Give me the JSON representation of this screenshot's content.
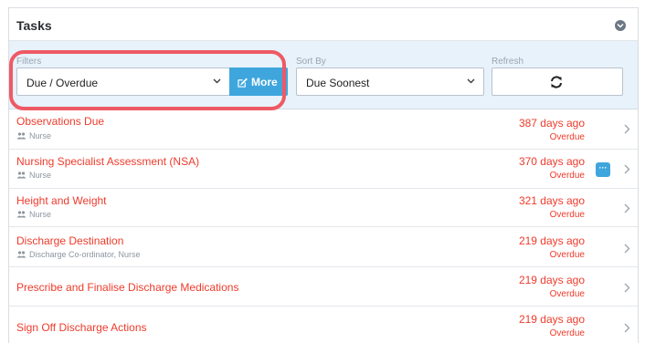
{
  "header": {
    "title": "Tasks"
  },
  "filters": {
    "filters_label": "Filters",
    "filter_value": "Due / Overdue",
    "more_label": "More",
    "sort_label": "Sort By",
    "sort_value": "Due Soonest",
    "refresh_label": "Refresh"
  },
  "tasks": [
    {
      "name": "Observations Due",
      "role": "Nurse",
      "ago": "387 days ago",
      "status": "Overdue"
    },
    {
      "name": "Nursing Specialist Assessment (NSA)",
      "role": "Nurse",
      "ago": "370 days ago",
      "status": "Overdue",
      "menu": "···"
    },
    {
      "name": "Height and Weight",
      "role": "Nurse",
      "ago": "321 days ago",
      "status": "Overdue"
    },
    {
      "name": "Discharge Destination",
      "role": "Discharge Co-ordinator, Nurse",
      "ago": "219 days ago",
      "status": "Overdue"
    },
    {
      "name": "Prescribe and Finalise Discharge Medications",
      "ago": "219 days ago",
      "status": "Overdue"
    },
    {
      "name": "Sign Off Discharge Actions",
      "ago": "219 days ago",
      "status": "Overdue"
    }
  ],
  "colors": {
    "overdue": "#ee3b2b",
    "accent": "#3fa6dd",
    "highlight": "#ee5a64",
    "filter_bg": "#e7f2fb"
  },
  "icons": [
    "chevron-down-circle-icon",
    "edit-icon",
    "refresh-icon",
    "people-icon",
    "chevron-right-icon"
  ]
}
